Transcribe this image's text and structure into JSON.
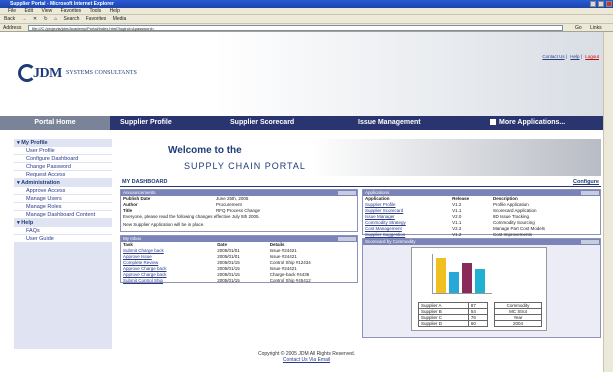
{
  "window_title": "Supplier Portal - Microsoft Internet Explorer",
  "menu": [
    "File",
    "Edit",
    "View",
    "Favorites",
    "Tools",
    "Help"
  ],
  "toolbar": [
    "Back",
    "Search",
    "Favorites",
    "Media"
  ],
  "address": {
    "label": "Address",
    "value": "file:///C:/projects/jdm/Academy/Portal/index.html?logind=&password=",
    "go": "Go",
    "links": "Links"
  },
  "header": {
    "logo": "JDM",
    "logo_sub": "SYSTEMS CONSULTANTS",
    "toplinks": [
      "Contact Us",
      "Help",
      "Logout"
    ]
  },
  "nav": [
    "Portal Home",
    "Supplier Profile",
    "Supplier Scorecard",
    "Issue Management",
    "More Applications..."
  ],
  "sidebar": [
    {
      "head": "My Profile",
      "items": [
        "User Profile",
        "Configure Dashboard",
        "Change Password",
        "Request Access"
      ]
    },
    {
      "head": "Administration",
      "items": [
        "Approve Access",
        "Manage Users",
        "Manage Roles",
        "Manage Dashboard Content"
      ]
    },
    {
      "head": "Help",
      "items": [
        "FAQs",
        "User Guide"
      ]
    }
  ],
  "welcome": {
    "line1": "Welcome to the",
    "line2": "SUPPLY CHAIN PORTAL"
  },
  "dashboard": {
    "title": "MY DASHBOARD",
    "configure": "Configure"
  },
  "announcements": {
    "title": "Announcements",
    "rows": [
      [
        "Publish Date",
        "June 25th, 2005"
      ],
      [
        "Author",
        "Procurement"
      ],
      [
        "Title",
        "RFQ Process Change"
      ]
    ],
    "text1": "Everyone, please read the following changes effective July 5th 2005.",
    "text2": "New Supplier Application will be in place."
  },
  "inbox": {
    "title": "My Inbox",
    "headers": [
      "Task",
      "Date",
      "Details"
    ],
    "rows": [
      [
        "Submit Charge back",
        "2005/01/01",
        "Issue #24421"
      ],
      [
        "Approve Issue",
        "2005/01/01",
        "Issue #24421"
      ],
      [
        "Complete Review",
        "2005/01/15",
        "Control Ship #12434"
      ],
      [
        "Approve Charge back",
        "2005/01/15",
        "Issue #24421"
      ],
      [
        "Approve Charge back",
        "2005/01/15",
        "Charge-back #4436"
      ],
      [
        "Submit Control Ship",
        "2005/01/15",
        "Control Ship #45412"
      ]
    ]
  },
  "applications": {
    "title": "Applications",
    "headers": [
      "Application",
      "Release",
      "Description"
    ],
    "rows": [
      [
        "Supplier Profile",
        "V1.2",
        "Profile Application"
      ],
      [
        "Supplier Scorecard",
        "V1.1",
        "Scorecard Application"
      ],
      [
        "Issue Manager",
        "V2.0",
        "8D Issue Tracking"
      ],
      [
        "Commodity Strategy",
        "V1.1",
        "Commodity Sourcing"
      ],
      [
        "Cost Management",
        "V2.2",
        "Manage Part Cost Models"
      ],
      [
        "Supplier Suggestion",
        "V1.2",
        "Cost Improvements"
      ]
    ]
  },
  "scorecard": {
    "title": "Scorecard by Commodity",
    "legend": [
      [
        "Supplier A",
        "87"
      ],
      [
        "Supplier B",
        "54"
      ],
      [
        "Supplier C",
        "76"
      ],
      [
        "Supplier D",
        "60"
      ]
    ],
    "side": [
      "Commodity",
      "MC Strut",
      "Year",
      "2004"
    ],
    "colors": [
      "#f0c020",
      "#28a8d8",
      "#8a2a5a",
      "#20b0d0"
    ]
  },
  "footer": {
    "copyright": "Copyright © 2005 JDM All Rights Reserved.",
    "contact": "Contact Us Via Email"
  }
}
